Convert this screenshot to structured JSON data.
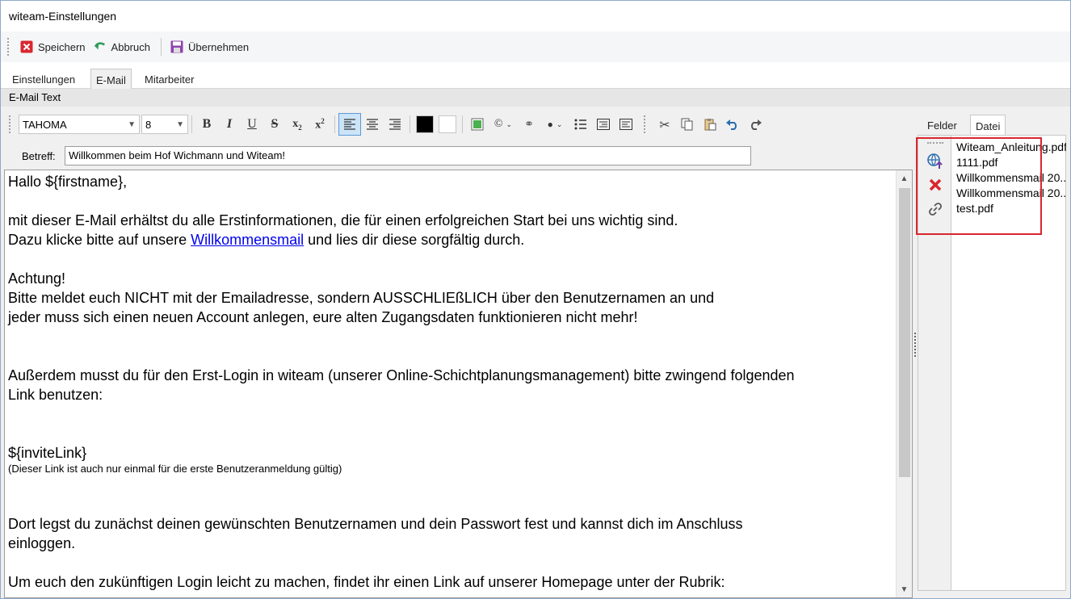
{
  "window": {
    "title": "witeam-Einstellungen"
  },
  "toolbar": {
    "save_label": "Speichern",
    "cancel_label": "Abbruch",
    "apply_label": "Übernehmen"
  },
  "tabs": [
    {
      "label": "Einstellungen"
    },
    {
      "label": "E-Mail"
    },
    {
      "label": "Mitarbeiter"
    }
  ],
  "section_title": "E-Mail Text",
  "format": {
    "font_family": "TAHOMA",
    "font_size": "8",
    "text_color": "#000000",
    "highlight_color": "#ffffff"
  },
  "subject": {
    "label": "Betreff:",
    "value": "Willkommen beim Hof Wichmann und Witeam!"
  },
  "body": {
    "greeting": "Hallo ${firstname},",
    "intro": "mit dieser E-Mail erhältst du alle Erstinformationen, die für einen erfolgreichen Start bei uns wichtig sind.",
    "line2_before": "Dazu klicke bitte auf unsere ",
    "line2_link": "Willkommensmail",
    "line2_after": " und lies dir diese sorgfältig durch.",
    "attention": "Achtung!",
    "warn1": "Bitte meldet euch NICHT mit der Emailadresse, sondern AUSSCHLIEßLICH über den Benutzernamen an und",
    "warn2": "jeder muss sich einen neuen Account anlegen, eure alten Zugangsdaten funktionieren nicht mehr!",
    "login1": "Außerdem musst du für den Erst-Login in witeam (unserer Online-Schichtplanungsmanagement) bitte zwingend folgenden",
    "login2": "Link benutzen:",
    "invite": "${inviteLink}",
    "invite_note": "(Dieser Link ist auch nur einmal für die erste Benutzeranmeldung gültig)",
    "setup1": "Dort legst du zunächst deinen gewünschten Benutzernamen und dein Passwort fest und kannst dich im Anschluss",
    "setup2": "einloggen.",
    "future": "Um euch den zukünftigen Login leicht zu machen, findet ihr einen Link auf unserer Homepage unter der Rubrik:"
  },
  "right_panel": {
    "tabs": [
      {
        "label": "Felder"
      },
      {
        "label": "Datei"
      }
    ],
    "files": [
      {
        "name": "Witeam_Anleitung.pdf"
      },
      {
        "name": "1111.pdf"
      },
      {
        "name": "Willkommensmail 20..."
      },
      {
        "name": "Willkommensmail 20..."
      },
      {
        "name": "test.pdf"
      }
    ]
  },
  "colors": {
    "accent_red": "#d9262f",
    "link_blue": "#0000ee",
    "active_tab_bg": "#cce4f7"
  }
}
